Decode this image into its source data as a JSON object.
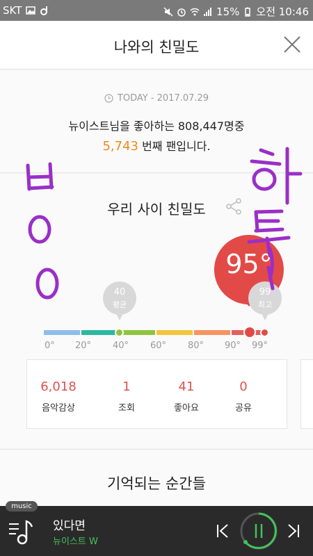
{
  "status_bar": {
    "carrier": "SKT",
    "battery": "15%",
    "time": "오전 10:46"
  },
  "header": {
    "title": "나와의 친밀도"
  },
  "today": {
    "label": "TODAY - 2017.07.29",
    "fans_text": "뉴이스트님을 좋아하는 808,447명중",
    "rank_number": "5,743",
    "rank_suffix": "번째 팬입니다."
  },
  "intimacy": {
    "title": "우리 사이 친밀도",
    "my_score": "95°",
    "avg_value": "40",
    "avg_label": "평균",
    "max_value": "99",
    "max_label": "최고",
    "ticks": [
      "0°",
      "20°",
      "40°",
      "60°",
      "80°",
      "90°",
      "99°"
    ]
  },
  "stats": [
    {
      "value": "6,018",
      "label": "음악감상"
    },
    {
      "value": "1",
      "label": "조회"
    },
    {
      "value": "41",
      "label": "좋아요"
    },
    {
      "value": "0",
      "label": "공유"
    }
  ],
  "moments": {
    "title": "기억되는 순간들"
  },
  "player": {
    "tag": "music",
    "song": "있다면",
    "artist": "뉴이스트 W"
  },
  "colors": {
    "accent_orange": "#f08a1c",
    "score_red": "#e24a47",
    "player_green": "#41c35a",
    "doodle_purple": "#9a2fc7"
  }
}
